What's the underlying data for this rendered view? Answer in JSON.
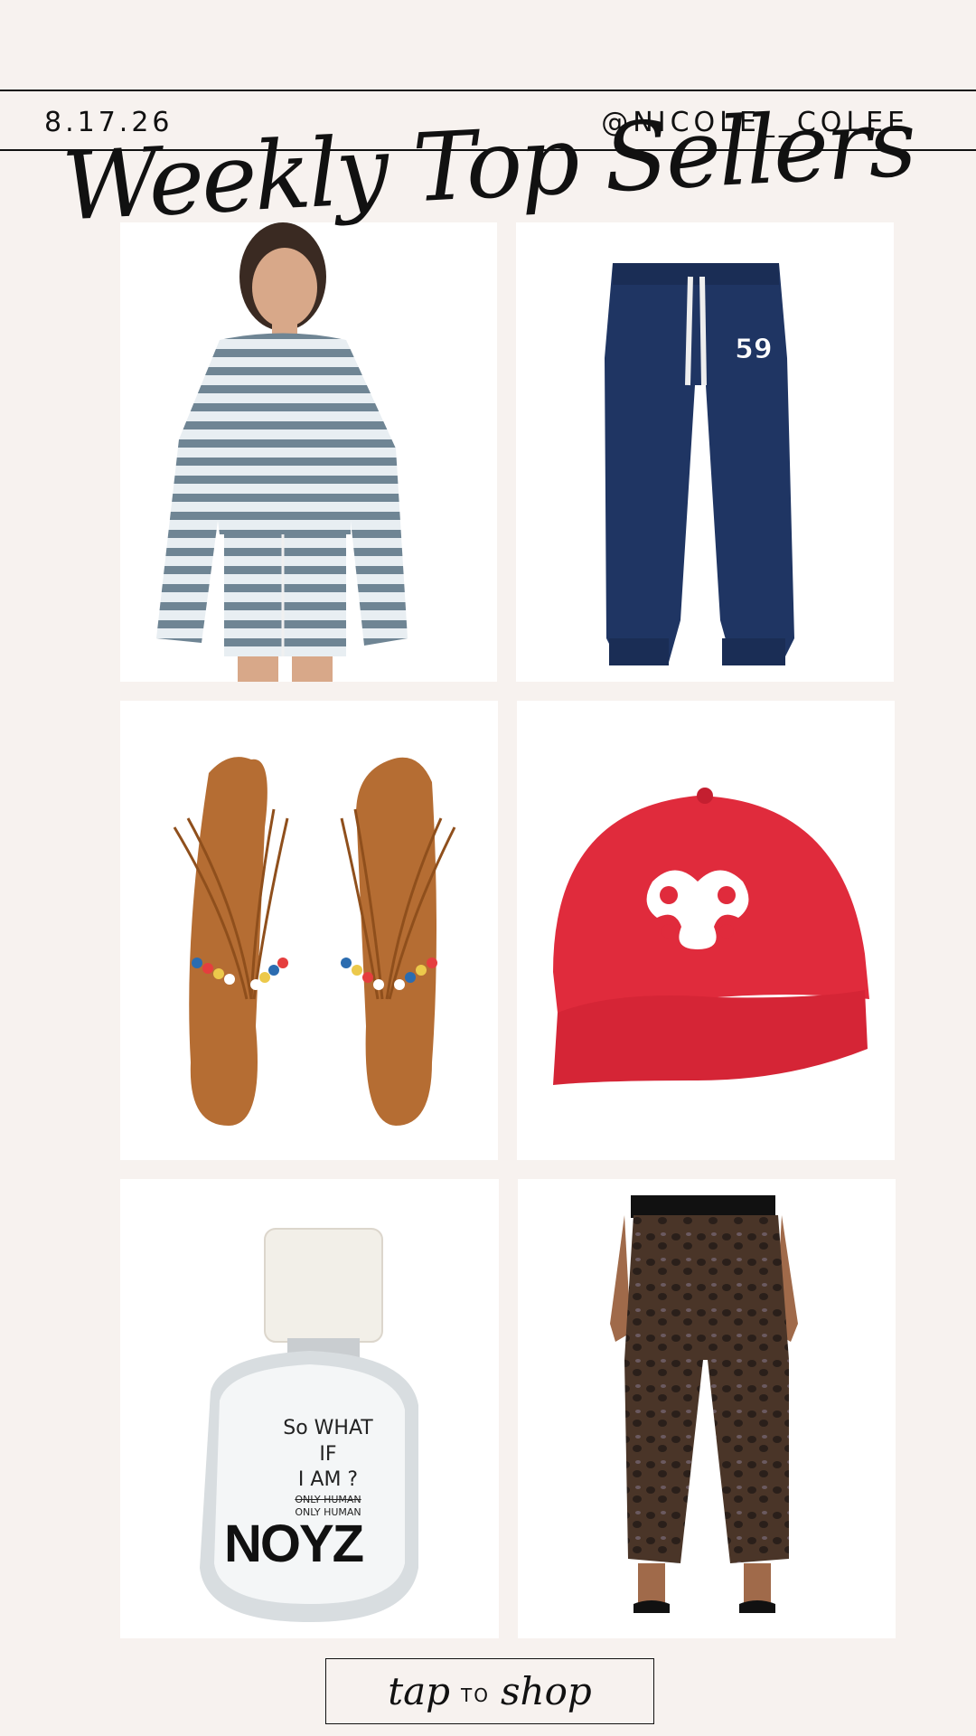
{
  "header": {
    "date": "8.17.26",
    "handle": "@NICOLE__COLEE",
    "title": "Weekly Top Sellers"
  },
  "products": [
    {
      "name": "striped-sweatshirt-shorts-set",
      "icon": "striped-set-image"
    },
    {
      "name": "navy-sweatpants",
      "icon": "navy-sweatpants-image",
      "print": "59"
    },
    {
      "name": "beaded-thong-sandals",
      "icon": "sandals-image"
    },
    {
      "name": "red-baseball-cap",
      "icon": "red-cap-image"
    },
    {
      "name": "noyz-perfume",
      "icon": "perfume-image",
      "label_lines": [
        "So WHAT",
        "IF",
        "I AM ?",
        "ONLY HUMAN",
        "ONLY HUMAN"
      ],
      "brand": "NOYZ"
    },
    {
      "name": "leopard-print-pants",
      "icon": "leopard-pants-image"
    }
  ],
  "cta": {
    "word1": "tap",
    "word2": "TO",
    "word3": "shop"
  }
}
